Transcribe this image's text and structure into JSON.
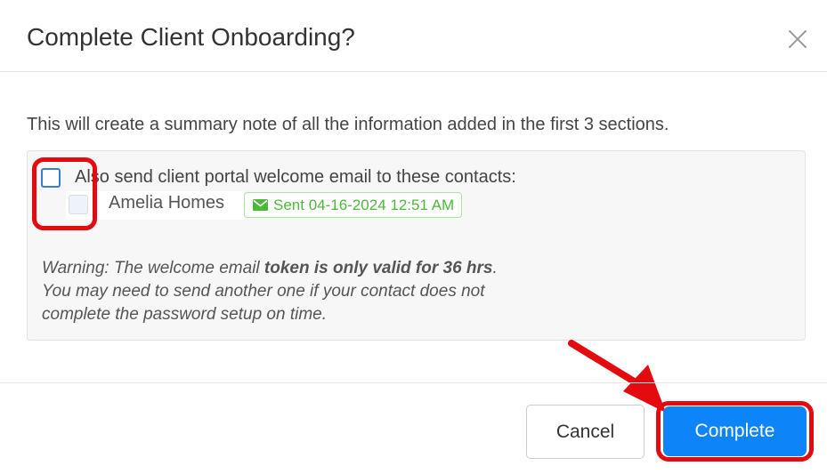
{
  "dialog": {
    "title": "Complete Client Onboarding?",
    "close_icon": "close-icon"
  },
  "body": {
    "intro": "This will create a summary note of all the information added in the first 3 sections.",
    "send_welcome_label": "Also send client portal welcome email to these contacts:",
    "send_welcome_checked": false,
    "contacts": [
      {
        "name": "Amelia Homes",
        "checked": false,
        "badge_icon": "envelope-icon",
        "badge_text": "Sent 04-16-2024 12:51 AM"
      }
    ],
    "warning": {
      "prefix": "Warning: The welcome email ",
      "emphasis": "token is only valid for 36 hrs",
      "suffix": ".",
      "line2": "You may need to send another one if your contact does not",
      "line3": "complete the password setup on time."
    }
  },
  "footer": {
    "cancel_label": "Cancel",
    "complete_label": "Complete"
  },
  "colors": {
    "primary": "#0d84f7",
    "success": "#4cb83a",
    "highlight": "#e30b10"
  }
}
